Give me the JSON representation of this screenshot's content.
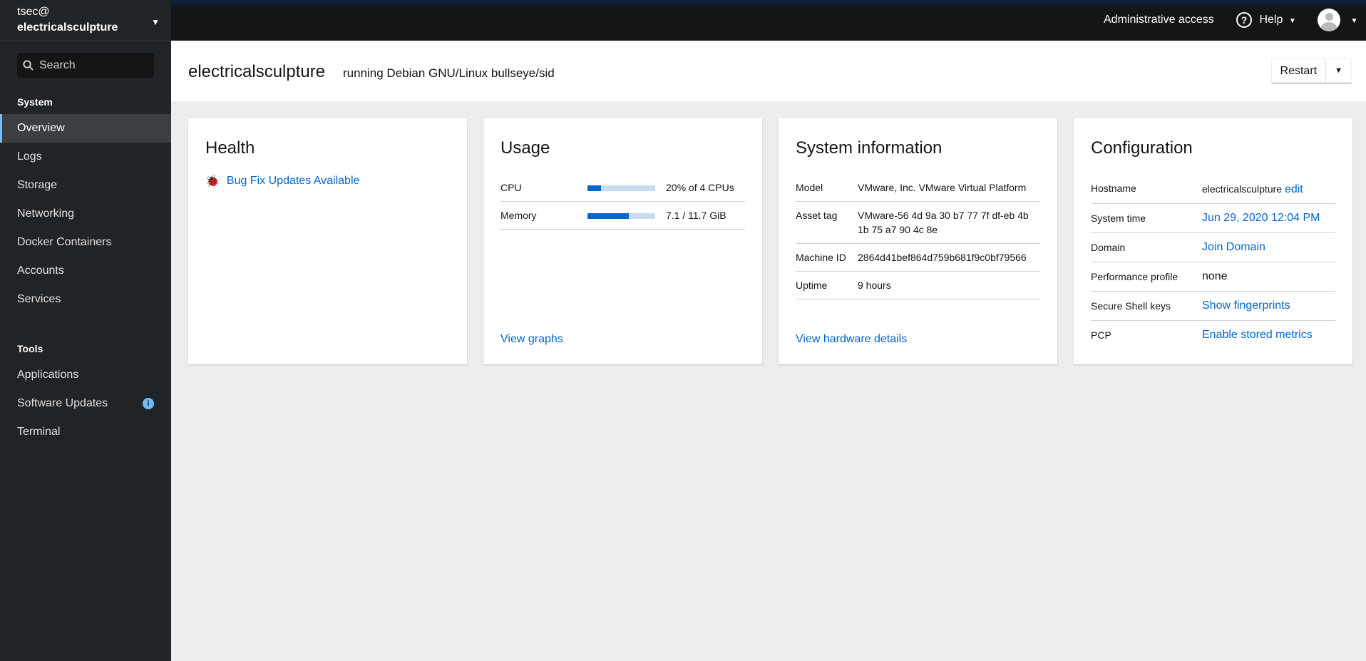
{
  "sidebar": {
    "user": "tsec@",
    "host": "electricalsculpture",
    "search_placeholder": "Search",
    "system_label": "System",
    "system_items": [
      "Overview",
      "Logs",
      "Storage",
      "Networking",
      "Docker Containers",
      "Accounts",
      "Services"
    ],
    "tools_label": "Tools",
    "tools_items": [
      "Applications",
      "Software Updates",
      "Terminal"
    ],
    "active": "Overview"
  },
  "topbar": {
    "admin": "Administrative access",
    "help": "Help"
  },
  "header": {
    "title": "electricalsculpture",
    "subtitle": "running Debian GNU/Linux bullseye/sid",
    "restart": "Restart"
  },
  "health": {
    "title": "Health",
    "item": "Bug Fix Updates Available"
  },
  "usage": {
    "title": "Usage",
    "rows": [
      {
        "label": "CPU",
        "percent": 20,
        "value": "20% of 4 CPUs"
      },
      {
        "label": "Memory",
        "percent": 61,
        "value": "7.1 / 11.7 GiB"
      }
    ],
    "link": "View graphs",
    "bar_color": "#0066cc",
    "bar_bg": "#c8dcf2"
  },
  "sysinfo": {
    "title": "System information",
    "rows": [
      {
        "label": "Model",
        "value": "VMware, Inc. VMware Virtual Platform"
      },
      {
        "label": "Asset tag",
        "value": "VMware-56 4d 9a 30 b7 77 7f df-eb 4b 1b 75 a7 90 4c 8e"
      },
      {
        "label": "Machine ID",
        "value": "2864d41bef864d759b681f9c0bf79566"
      },
      {
        "label": "Uptime",
        "value": "9 hours"
      }
    ],
    "link": "View hardware details"
  },
  "config": {
    "title": "Configuration",
    "hostname_label": "Hostname",
    "hostname": "electricalsculpture",
    "edit": "edit",
    "time_label": "System time",
    "time": "Jun 29, 2020 12:04 PM",
    "domain_label": "Domain",
    "domain": "Join Domain",
    "perf_label": "Performance profile",
    "perf": "none",
    "ssh_label": "Secure Shell keys",
    "ssh": "Show fingerprints",
    "pcp_label": "PCP",
    "pcp": "Enable stored metrics"
  }
}
